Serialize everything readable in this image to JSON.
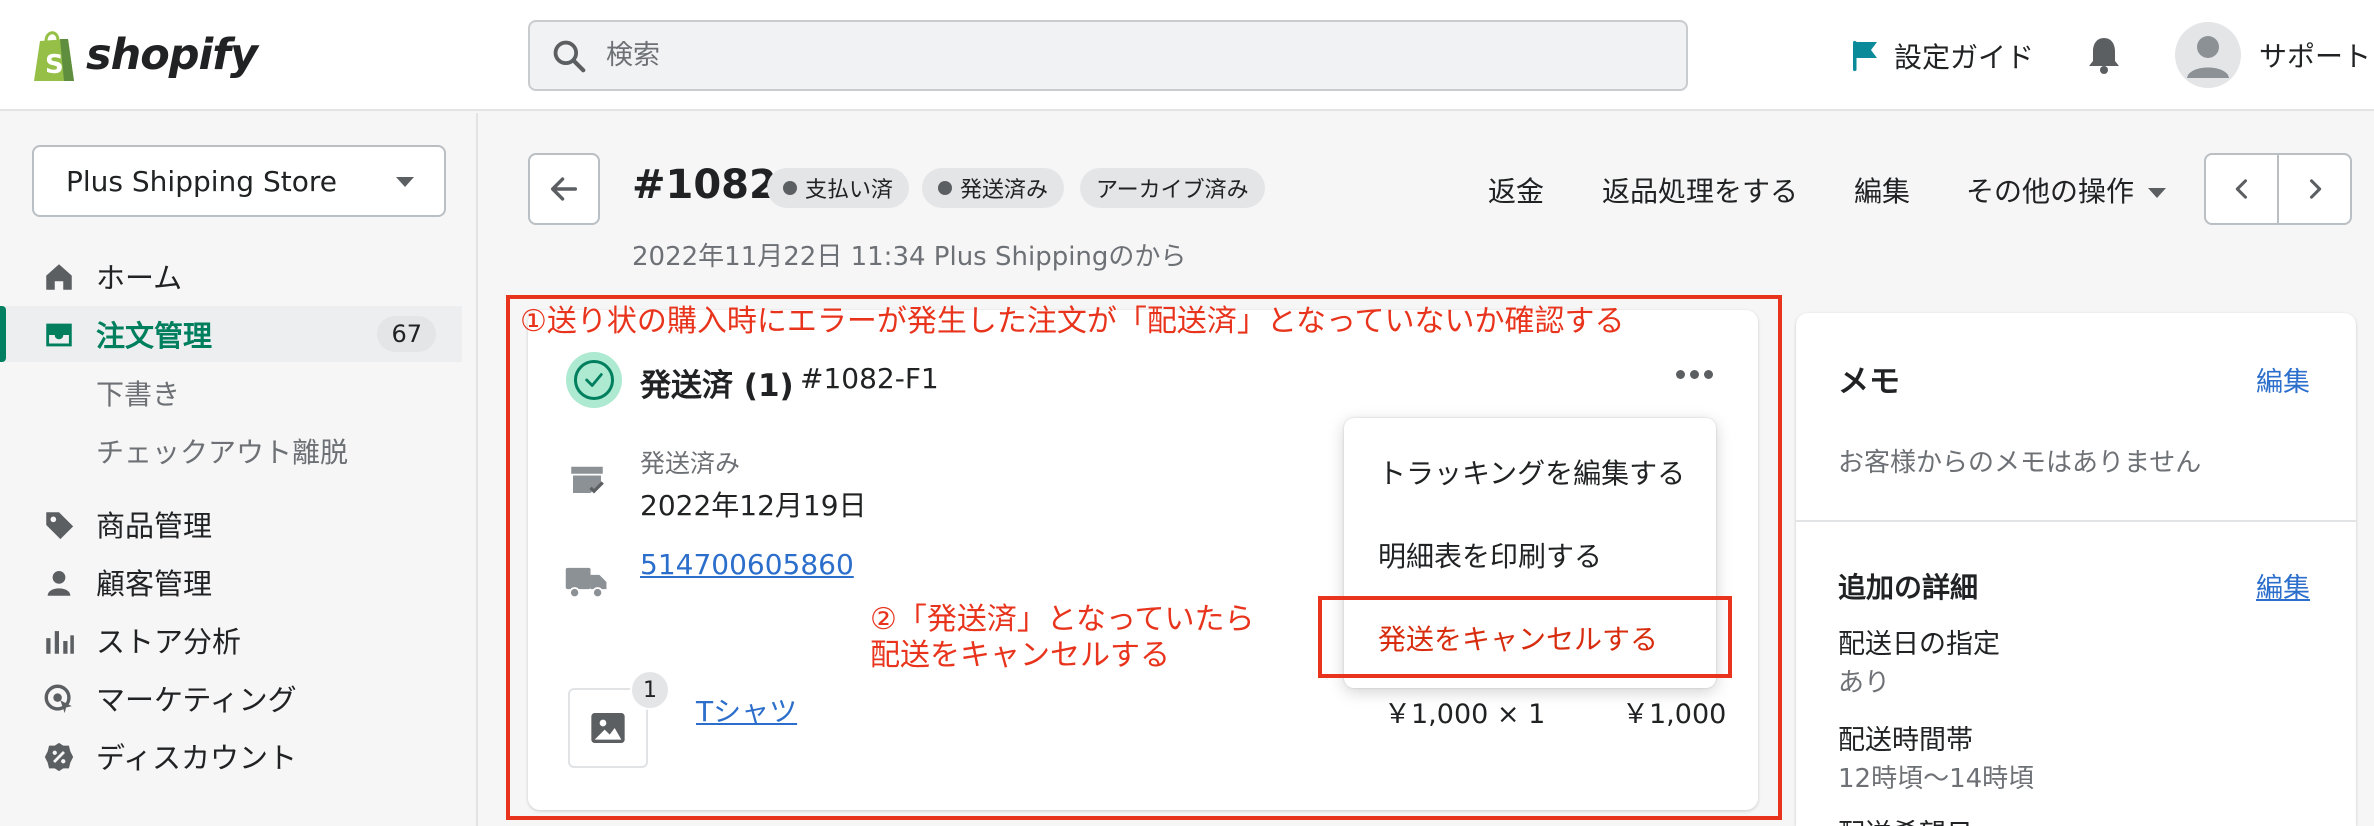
{
  "topbar": {
    "brand": "shopify",
    "search_placeholder": "検索",
    "setup_guide": "設定ガイド",
    "user_name": "サポート"
  },
  "sidebar": {
    "store_name": "Plus Shipping Store",
    "items": [
      {
        "label": "ホーム",
        "icon": "home-icon"
      },
      {
        "label": "注文管理",
        "icon": "orders-icon",
        "badge": "67",
        "active": true
      },
      {
        "label": "商品管理",
        "icon": "tag-icon"
      },
      {
        "label": "顧客管理",
        "icon": "person-icon"
      },
      {
        "label": "ストア分析",
        "icon": "bar-chart-icon"
      },
      {
        "label": "マーケティング",
        "icon": "marketing-icon"
      },
      {
        "label": "ディスカウント",
        "icon": "discount-icon"
      }
    ],
    "sub_items": [
      "下書き",
      "チェックアウト離脱"
    ]
  },
  "order": {
    "number": "#1082",
    "badges": [
      "支払い済",
      "発送済み",
      "アーカイブ済み"
    ],
    "subtitle": "2022年11月22日 11:34 Plus Shippingのから",
    "actions": {
      "refund": "返金",
      "return": "返品処理をする",
      "edit": "編集",
      "more": "その他の操作"
    }
  },
  "fulfillment": {
    "title": "発送済 (1)",
    "id": "#1082-F1",
    "shipped_label": "発送済み",
    "shipped_date": "2022年12月19日",
    "tracking_number": "514700605860",
    "item_qty": "1",
    "product_name": "Tシャツ",
    "unit_price": "￥1,000 × 1",
    "total": "￥1,000"
  },
  "menu": {
    "items": [
      "トラッキングを編集する",
      "明細表を印刷する",
      "発送をキャンセルする"
    ]
  },
  "annotations": {
    "step1": "①送り状の購入時にエラーが発生した注文が「配送済」となっていないか確認する",
    "step2_line1": "②「発送済」となっていたら",
    "step2_line2": "配送をキャンセルする"
  },
  "memo": {
    "title": "メモ",
    "edit": "編集",
    "empty": "お客様からのメモはありません"
  },
  "details": {
    "title": "追加の詳細",
    "edit": "編集",
    "fields": [
      {
        "label": "配送日の指定",
        "value": "あり"
      },
      {
        "label": "配送時間帯",
        "value": "12時頃〜14時頃"
      },
      {
        "label": "配送希望日",
        "value": ""
      }
    ]
  },
  "colors": {
    "accent_green": "#008060",
    "link_blue": "#2c6ecb",
    "annotation_red": "#e8341c",
    "danger_red": "#d72c0d"
  }
}
